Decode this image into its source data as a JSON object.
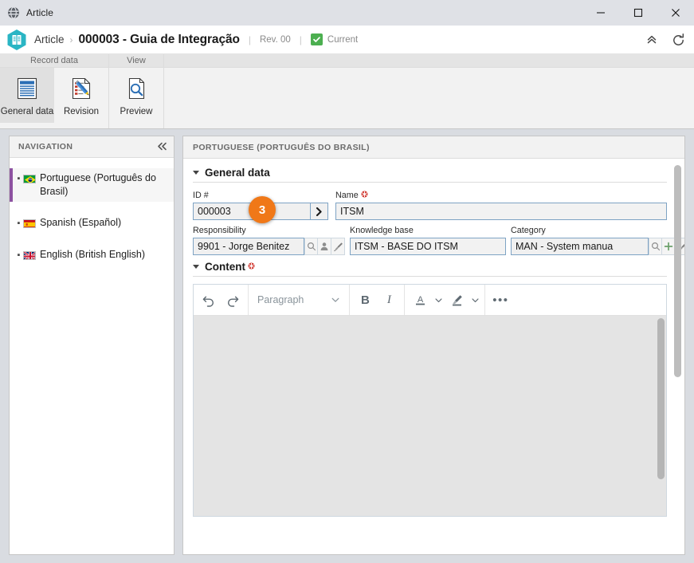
{
  "window": {
    "title": "Article",
    "icon": "globe-icon",
    "controls": {
      "minimize": "—",
      "maximize": "□",
      "close": "✕"
    }
  },
  "header": {
    "breadcrumb_root": "Article",
    "breadcrumb_sep": "›",
    "breadcrumb_main": "000003 - Guia de Integração",
    "divider": "|",
    "revision": "Rev. 00",
    "divider2": "|",
    "status": "Current",
    "status_color": "#4caf50",
    "actions": [
      {
        "name": "collapse-header-icon",
        "glyph": "«"
      },
      {
        "name": "refresh-icon",
        "glyph": "↻"
      }
    ]
  },
  "ribbon": {
    "groups": [
      {
        "title": "Record data",
        "buttons": [
          {
            "label": "General data",
            "icon": "document-lines-icon",
            "active": true
          },
          {
            "label": "Revision",
            "icon": "document-pencil-icon",
            "active": false
          }
        ]
      },
      {
        "title": "View",
        "buttons": [
          {
            "label": "Preview",
            "icon": "document-magnifier-icon",
            "active": false
          }
        ]
      }
    ]
  },
  "navigation": {
    "title": "NAVIGATION",
    "collapse_glyph": "«",
    "items": [
      {
        "label": "Portuguese (Português do Brasil)",
        "flag": "flag-brazil",
        "selected": true
      },
      {
        "label": "Spanish (Español)",
        "flag": "flag-spain",
        "selected": false
      },
      {
        "label": "English (British English)",
        "flag": "flag-uk",
        "selected": false
      }
    ],
    "selected_accent": "#8d52a1"
  },
  "form": {
    "panel_title": "PORTUGUESE (PORTUGUÊS DO BRASIL)",
    "sections": {
      "general": {
        "title": "General data",
        "expanded": true
      },
      "content": {
        "title": "Content",
        "expanded": true,
        "required": true
      }
    },
    "fields": {
      "id": {
        "label": "ID #",
        "value": "000003",
        "button_glyph": "❯"
      },
      "name": {
        "label": "Name",
        "required": true,
        "value": "ITSM"
      },
      "responsibility": {
        "label": "Responsibility",
        "value": "9901 - Jorge Benitez",
        "buttons": [
          "search-icon",
          "user-icon",
          "brush-icon"
        ]
      },
      "knowledge_base": {
        "label": "Knowledge base",
        "value": "ITSM - BASE DO ITSM"
      },
      "category": {
        "label": "Category",
        "value": "MAN - System manua",
        "buttons": [
          "search-icon",
          "plus-icon",
          "brush-icon"
        ]
      }
    },
    "badge": {
      "number": "3",
      "color": "#f07818"
    }
  },
  "editor": {
    "toolbar": {
      "undo": "undo-icon",
      "redo": "redo-icon",
      "paragraph_label": "Paragraph",
      "bold": "B",
      "italic": "I",
      "font_color": "A",
      "highlight": "highlighter-icon",
      "more": "•••"
    },
    "content": ""
  },
  "statusbar": {
    "ghost_left": "",
    "ghost_right": ""
  }
}
